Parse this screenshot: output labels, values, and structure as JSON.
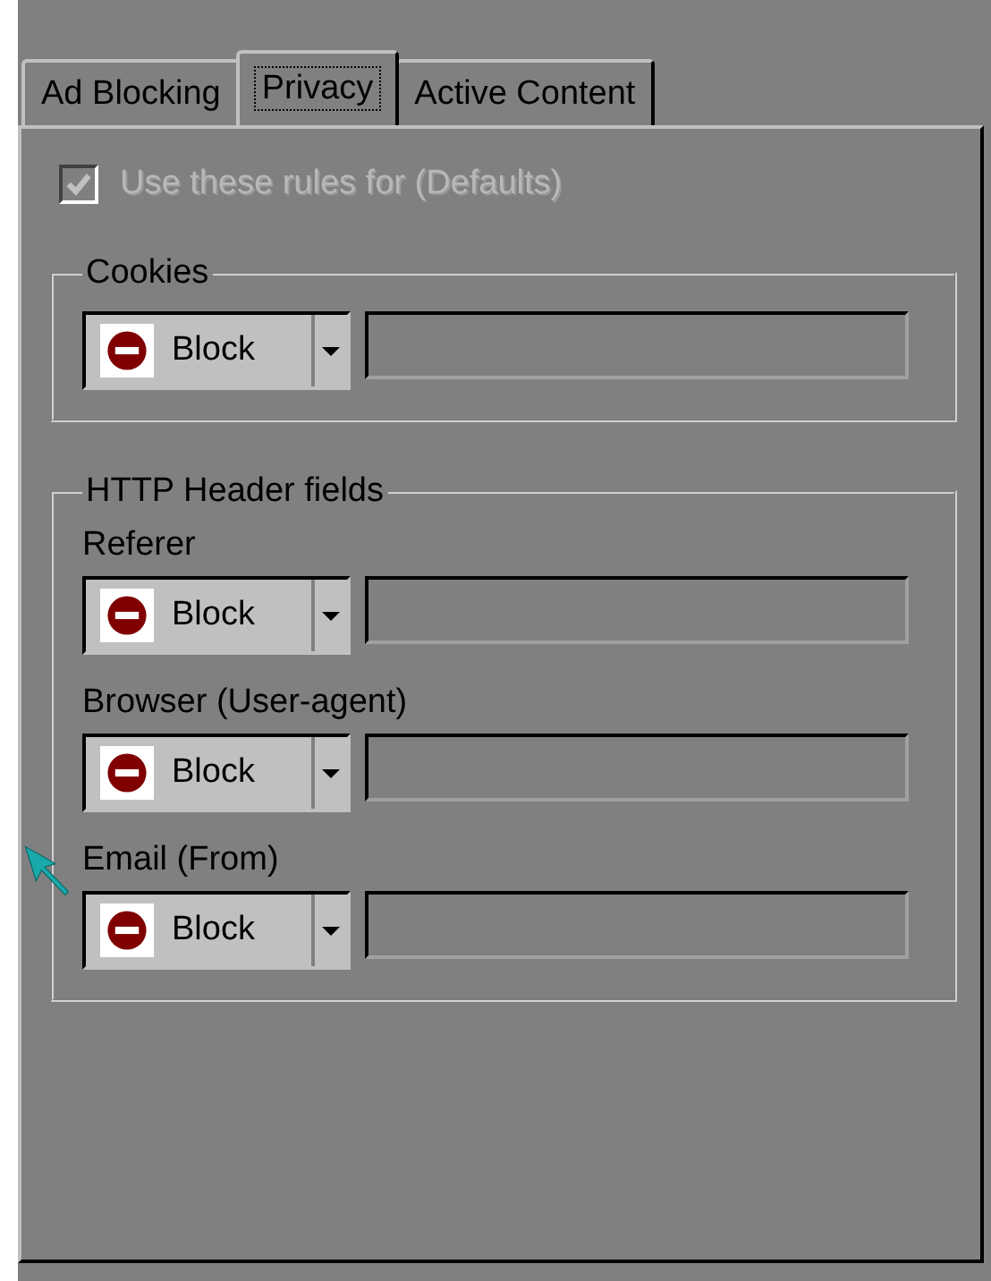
{
  "tabs": [
    {
      "label": "Ad Blocking",
      "selected": false
    },
    {
      "label": "Privacy",
      "selected": true
    },
    {
      "label": "Active Content",
      "selected": false
    }
  ],
  "use_rules": {
    "label": "Use these rules for (Defaults)",
    "checked": true,
    "disabled": true
  },
  "groups": [
    {
      "title": "Cookies",
      "rows": [
        {
          "value": "Block"
        }
      ]
    },
    {
      "title": "HTTP Header fields",
      "rows": [
        {
          "label": "Referer",
          "value": "Block"
        },
        {
          "label": "Browser (User-agent)",
          "value": "Block"
        },
        {
          "label": "Email (From)",
          "value": "Block"
        }
      ]
    }
  ]
}
